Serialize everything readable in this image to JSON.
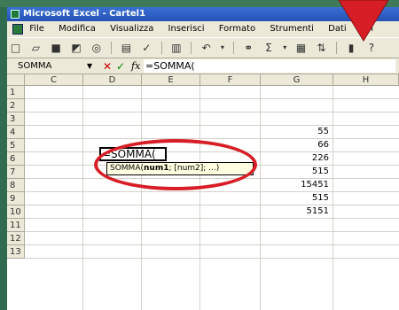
{
  "window": {
    "title": "Microsoft Excel - Cartel1"
  },
  "menu": [
    "File",
    "Modifica",
    "Visualizza",
    "Inserisci",
    "Formato",
    "Strumenti",
    "Dati",
    "Fin"
  ],
  "formula_bar": {
    "name_box": "SOMMA",
    "cancel_symbol": "✕",
    "enter_symbol": "✓",
    "fx_label": "fx",
    "formula": "=SOMMA("
  },
  "columns": [
    "C",
    "D",
    "E",
    "F",
    "G",
    "H"
  ],
  "rows": [
    "1",
    "2",
    "3",
    "4",
    "5",
    "6",
    "7",
    "8",
    "9",
    "10",
    "11",
    "12",
    "13"
  ],
  "column_g_values": {
    "row4": "55",
    "row5": "66",
    "row6": "226",
    "row7": "515",
    "row8": "15451",
    "row9": "515",
    "row10": "5151"
  },
  "active_cell": {
    "text": "=SOMMA("
  },
  "tooltip": {
    "func": "SOMMA(",
    "arg_bold": "num1",
    "rest": "; [num2]; ...)"
  },
  "colors": {
    "highlight_red": "#d71e26",
    "frame_green": "#2f6b4f"
  }
}
